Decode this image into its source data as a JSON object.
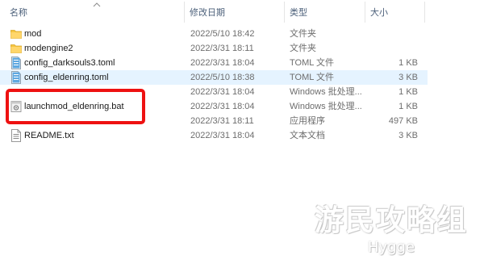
{
  "header": {
    "name": "名称",
    "date": "修改日期",
    "type": "类型",
    "size": "大小"
  },
  "files": [
    {
      "name": "mod",
      "date": "2022/5/10 18:42",
      "type": "文件夹",
      "size": "",
      "icon": "folder-icon"
    },
    {
      "name": "modengine2",
      "date": "2022/3/31 18:11",
      "type": "文件夹",
      "size": "",
      "icon": "folder-icon"
    },
    {
      "name": "config_darksouls3.toml",
      "date": "2022/3/31 18:04",
      "type": "TOML 文件",
      "size": "1 KB",
      "icon": "toml-file-icon"
    },
    {
      "name": "config_eldenring.toml",
      "date": "2022/5/10 18:38",
      "type": "TOML 文件",
      "size": "3 KB",
      "icon": "toml-file-icon"
    },
    {
      "name": "",
      "date": "2022/3/31 18:04",
      "type": "Windows 批处理...",
      "size": "1 KB",
      "icon": "batch-file-icon"
    },
    {
      "name": "launchmod_eldenring.bat",
      "date": "2022/3/31 18:04",
      "type": "Windows 批处理...",
      "size": "1 KB",
      "icon": "batch-file-icon"
    },
    {
      "name": "",
      "date": "2022/3/31 18:11",
      "type": "应用程序",
      "size": "497 KB",
      "icon": "application-icon"
    },
    {
      "name": "README.txt",
      "date": "2022/3/31 18:04",
      "type": "文本文档",
      "size": "3 KB",
      "icon": "text-file-icon"
    }
  ],
  "watermark": {
    "main": "游民攻略组",
    "sub": "Hygge"
  },
  "colors": {
    "folder": "#f5c542",
    "callout": "#ee1111",
    "header_text": "#4c607a"
  }
}
